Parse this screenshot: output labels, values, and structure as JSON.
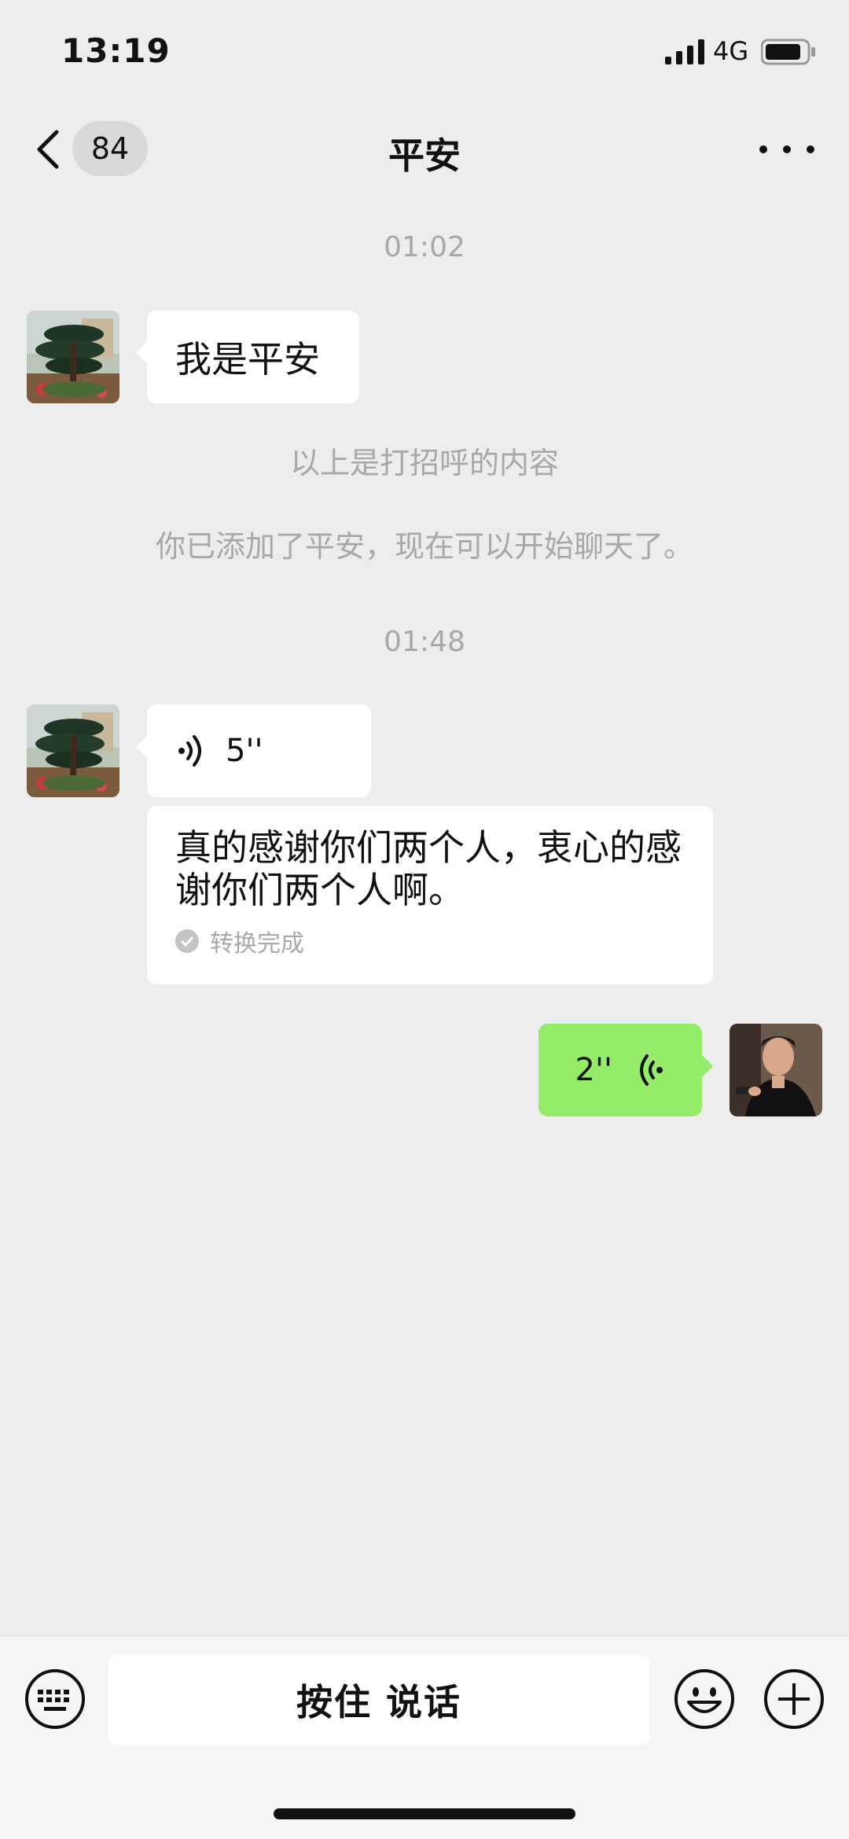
{
  "status_bar": {
    "time": "13:19",
    "network": "4G"
  },
  "nav": {
    "unread_count": "84",
    "title": "平安"
  },
  "messages": {
    "time1": "01:02",
    "greeting_text": "我是平安",
    "sys1": "以上是打招呼的内容",
    "sys2": "你已添加了平安，现在可以开始聊天了。",
    "time2": "01:48",
    "voice_in_duration": "5''",
    "transcript": "真的感谢你们两个人，衷心的感谢你们两个人啊。",
    "transcript_status": "转换完成",
    "voice_out_duration": "2''"
  },
  "input_bar": {
    "talk_label": "按住 说话"
  },
  "icons": [
    "back-icon",
    "more-icon",
    "voice-icon",
    "check-icon",
    "keyboard-icon",
    "emoji-icon",
    "plus-icon",
    "signal-icon",
    "battery-icon"
  ],
  "colors": {
    "background": "#ededed",
    "sent_bubble": "#95ec69",
    "received_bubble": "#ffffff",
    "meta_text": "#a8a8a8"
  }
}
